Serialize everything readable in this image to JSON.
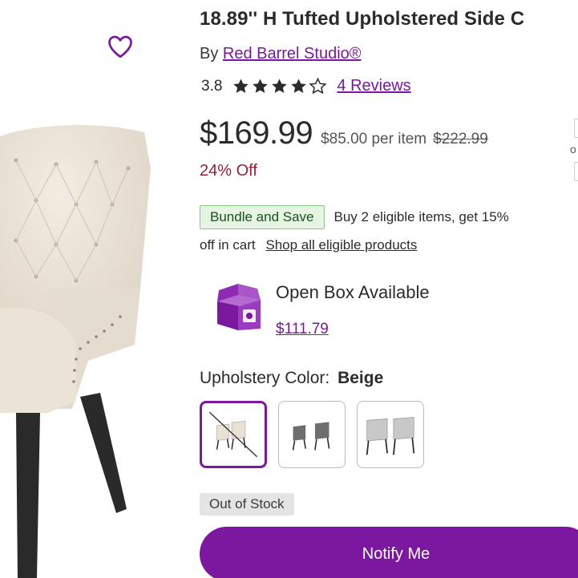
{
  "product": {
    "title": "18.89'' H Tufted Upholstered Side C",
    "by_prefix": "By",
    "brand": "Red Barrel Studio®",
    "rating": "3.8",
    "stars_filled": 4,
    "stars_total": 5,
    "reviews_label": "4 Reviews",
    "price": "$169.99",
    "per_item": "$85.00 per item",
    "was_price": "$222.99",
    "discount": "24% Off"
  },
  "bundle": {
    "badge": "Bundle and Save",
    "text_line1": "Buy 2 eligible items, get 15%",
    "text_line2": "off in cart",
    "link": "Shop all eligible products"
  },
  "open_box": {
    "title": "Open Box Available",
    "price": "$111.79"
  },
  "options": {
    "label": "Upholstery Color:",
    "selected": "Beige",
    "swatches": [
      {
        "name": "beige",
        "selected": true,
        "unavailable": true
      },
      {
        "name": "gray",
        "selected": false,
        "unavailable": false
      },
      {
        "name": "light-gray",
        "selected": false,
        "unavailable": false
      }
    ]
  },
  "stock": {
    "status": "Out of Stock",
    "action": "Notify Me"
  },
  "edge": {
    "text": "o"
  },
  "colors": {
    "accent": "#7b189f",
    "discount": "#9b1d3b",
    "bundle_bg": "#e6f5e3",
    "chair_beige": "#ebe3d6",
    "chair_legs": "#2a2a2a"
  }
}
